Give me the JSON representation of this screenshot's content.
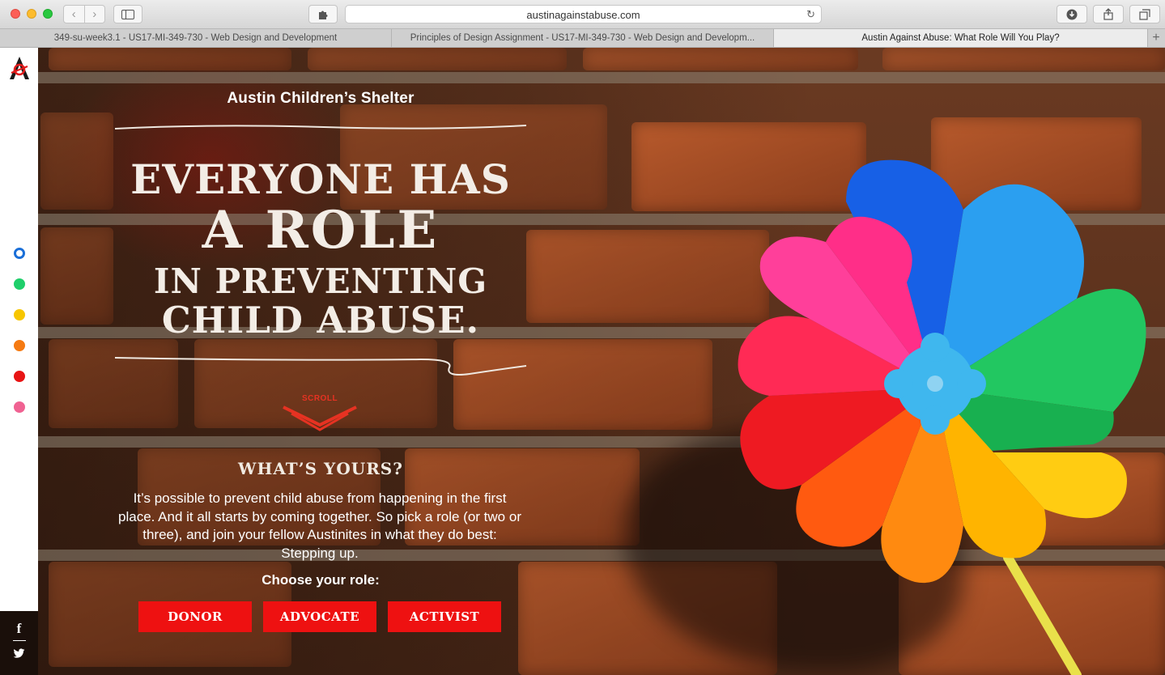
{
  "browser": {
    "url": "austinagainstabuse.com",
    "tabs": [
      {
        "label": "349-su-week3.1 - US17-MI-349-730 - Web Design and Development",
        "active": false
      },
      {
        "label": "Principles of Design Assignment - US17-MI-349-730 - Web Design and Developm...",
        "active": false
      },
      {
        "label": "Austin Against Abuse: What Role Will You Play?",
        "active": true
      }
    ]
  },
  "sidebar": {
    "logo_icon": "austin-against-abuse-logo-icon",
    "dots": [
      {
        "name": "section-dot-1",
        "color": "#1a6fd8",
        "active": true
      },
      {
        "name": "section-dot-2",
        "color": "#1fcf6b",
        "active": false
      },
      {
        "name": "section-dot-3",
        "color": "#f7c600",
        "active": false
      },
      {
        "name": "section-dot-4",
        "color": "#f57a12",
        "active": false
      },
      {
        "name": "section-dot-5",
        "color": "#e81414",
        "active": false
      },
      {
        "name": "section-dot-6",
        "color": "#f06292",
        "active": false
      }
    ],
    "social": {
      "facebook": "f",
      "twitter": "twitter-icon"
    }
  },
  "hero": {
    "org": "Austin Children’s Shelter",
    "headline_1": "EVERYONE HAS",
    "headline_2": "A ROLE",
    "headline_3": "IN PREVENTING",
    "headline_4": "CHILD ABUSE.",
    "scroll_label": "SCROLL",
    "whats_yours": "WHAT’S YOURS?",
    "copy": "It’s possible to prevent child abuse from happening in the first place. And it all starts by coming together. So pick a role (or two or three), and join your fellow Austinites in what they do best: Stepping up.",
    "choose": "Choose your role:",
    "roles": [
      "DONOR",
      "ADVOCATE",
      "ACTIVIST"
    ]
  },
  "colors": {
    "accent_red": "#ee1111",
    "sidebar_bg": "#ffffff"
  }
}
